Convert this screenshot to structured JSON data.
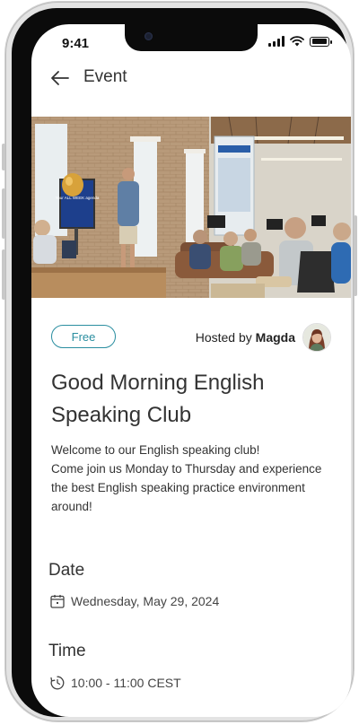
{
  "status_bar": {
    "time": "9:41"
  },
  "header": {
    "title": "Event",
    "back_icon": "arrow-left-icon"
  },
  "event": {
    "price_badge": "Free",
    "hosted_by_prefix": "Hosted by",
    "host_name": "Magda",
    "title": "Good Morning English Speaking Club",
    "description_line1": "Welcome to our English speaking club!",
    "description_line2": "Come join us Monday to Thursday and experience the best English speaking practice environment around!",
    "date_label": "Date",
    "date_value": "Wednesday, May 29, 2024",
    "date_icon": "calendar-icon",
    "time_label": "Time",
    "time_value": "10:00 - 11:00 CEST",
    "time_icon": "clock-icon",
    "screen_text": "Your ALL WEEK agenda"
  },
  "colors": {
    "accent": "#2a8ea0",
    "text": "#333333"
  }
}
